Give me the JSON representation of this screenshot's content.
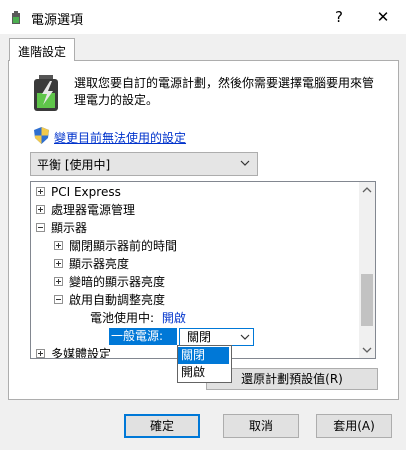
{
  "window": {
    "title": "電源選項",
    "help_label": "?",
    "close_label": "✕"
  },
  "tab": {
    "label": "進階設定"
  },
  "description": "選取您要自訂的電源計劃，然後你需要選擇電腦要用來管理電力的設定。",
  "change_link": "變更目前無法使用的設定",
  "plan_select": {
    "value": "平衡 [使用中]"
  },
  "tree": {
    "items": [
      {
        "label": "PCI Express",
        "toggle": "+"
      },
      {
        "label": "處理器電源管理",
        "toggle": "+"
      },
      {
        "label": "顯示器",
        "toggle": "-"
      },
      {
        "label": "關閉顯示器前的時間",
        "toggle": "+"
      },
      {
        "label": "顯示器亮度",
        "toggle": "+"
      },
      {
        "label": "變暗的顯示器亮度",
        "toggle": "+"
      },
      {
        "label": "啟用自動調整亮度",
        "toggle": "-"
      },
      {
        "label": "多媒體設定",
        "toggle": "+"
      }
    ],
    "battery_label": "電池使用中:",
    "battery_value": "開啟",
    "ac_label": "一般電源:",
    "ac_value": "關閉"
  },
  "dropdown": {
    "options": [
      "關閉",
      "開啟"
    ]
  },
  "restore_button": "還原計劃預設值(R)",
  "buttons": {
    "ok": "確定",
    "cancel": "取消",
    "apply": "套用(A)"
  },
  "colors": {
    "accent": "#0078d7",
    "link": "#0033cc"
  },
  "icons": {
    "title": "power-options-icon",
    "battery": "battery-icon",
    "shield": "uac-shield-icon"
  }
}
